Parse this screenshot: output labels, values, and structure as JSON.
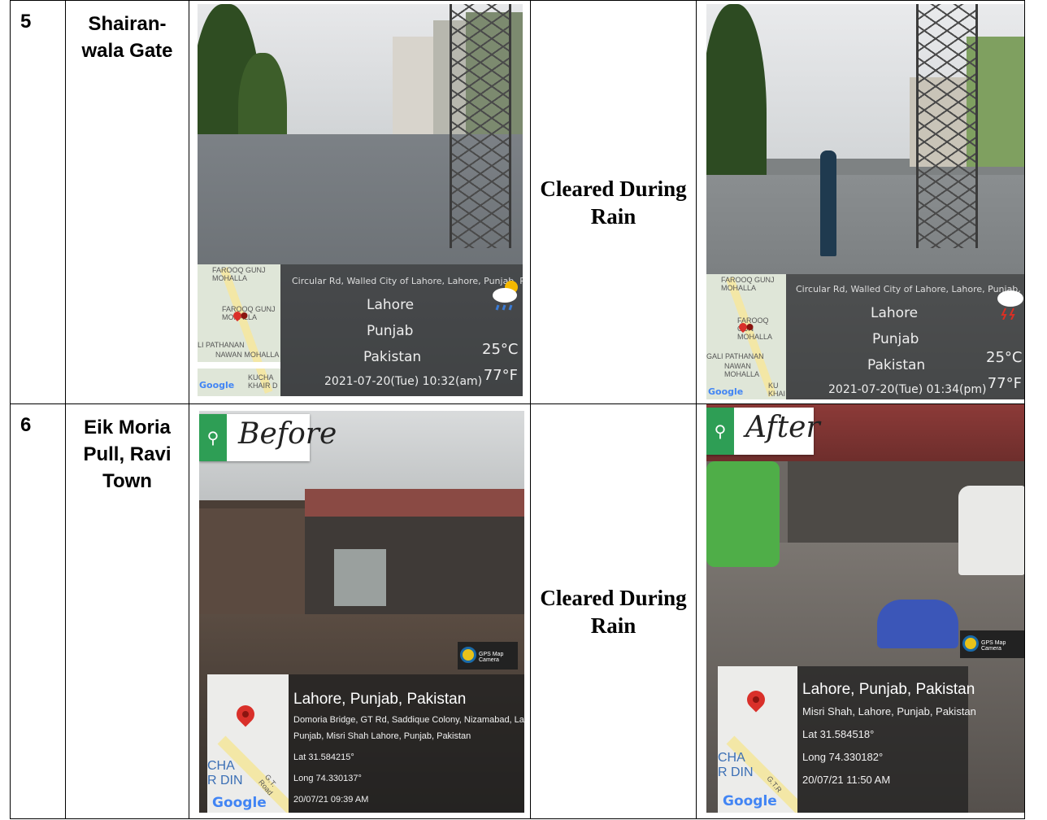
{
  "rows": [
    {
      "number": "5",
      "location": "Shairan-\nwala Gate",
      "status": "Cleared During Rain",
      "before": {
        "address": "Circular Rd, Walled City of Lahore, Lahore, Punjab, Pakistan",
        "city": "Lahore",
        "province": "Punjab",
        "country": "Pakistan",
        "temp_c": "25°C",
        "temp_f": "77°F",
        "datetime": "2021-07-20(Tue)  10:32(am)",
        "map_labels": [
          "FAROOQ GUNJ MOHALLA",
          "FAROOQ GUNJ MOHALLA",
          "LI PATHANAN",
          "NAWAN MOHALLA",
          "KUCHA KHAIR D"
        ],
        "map_brand": "Google"
      },
      "after": {
        "address": "Circular Rd, Walled City of Lahore, Lahore, Punjab, Pakistan",
        "city": "Lahore",
        "province": "Punjab",
        "country": "Pakistan",
        "temp_c": "25°C",
        "temp_f": "77°F",
        "datetime": "2021-07-20(Tue)  01:34(pm)",
        "map_labels": [
          "FAROOQ GUNJ MOHALLA",
          "FAROOQ GUN MOHALLA",
          "GALI PATHANAN",
          "NAWAN MOHALLA",
          "KU KHAI"
        ],
        "map_brand": "Google"
      }
    },
    {
      "number": "6",
      "location": "Eik Moria\nPull, Ravi\nTown",
      "status": "Cleared During Rain",
      "before": {
        "banner": "Before",
        "badge": "GPS Map Camera",
        "title": "Lahore, Punjab, Pakistan",
        "lines": [
          "Domoria Bridge, GT Rd, Saddique Colony, Nizamabad, Lahore,",
          "Punjab, Misri Shah Lahore, Punjab, Pakistan",
          "Lat 31.584215°",
          "Long 74.330137°",
          "20/07/21 09:39 AM"
        ],
        "map_labels": [
          "CHA",
          "R DIN",
          "G.T. Road"
        ],
        "map_brand": "Google"
      },
      "after": {
        "banner": "After",
        "badge": "GPS Map Camera",
        "title": "Lahore, Punjab, Pakistan",
        "lines": [
          "Misri Shah, Lahore, Punjab, Pakistan",
          "Lat 31.584518°",
          "Long 74.330182°",
          "20/07/21 11:50 AM"
        ],
        "map_labels": [
          "CHA",
          "R DIN",
          "G.T.R"
        ],
        "map_brand": "Google"
      }
    }
  ]
}
